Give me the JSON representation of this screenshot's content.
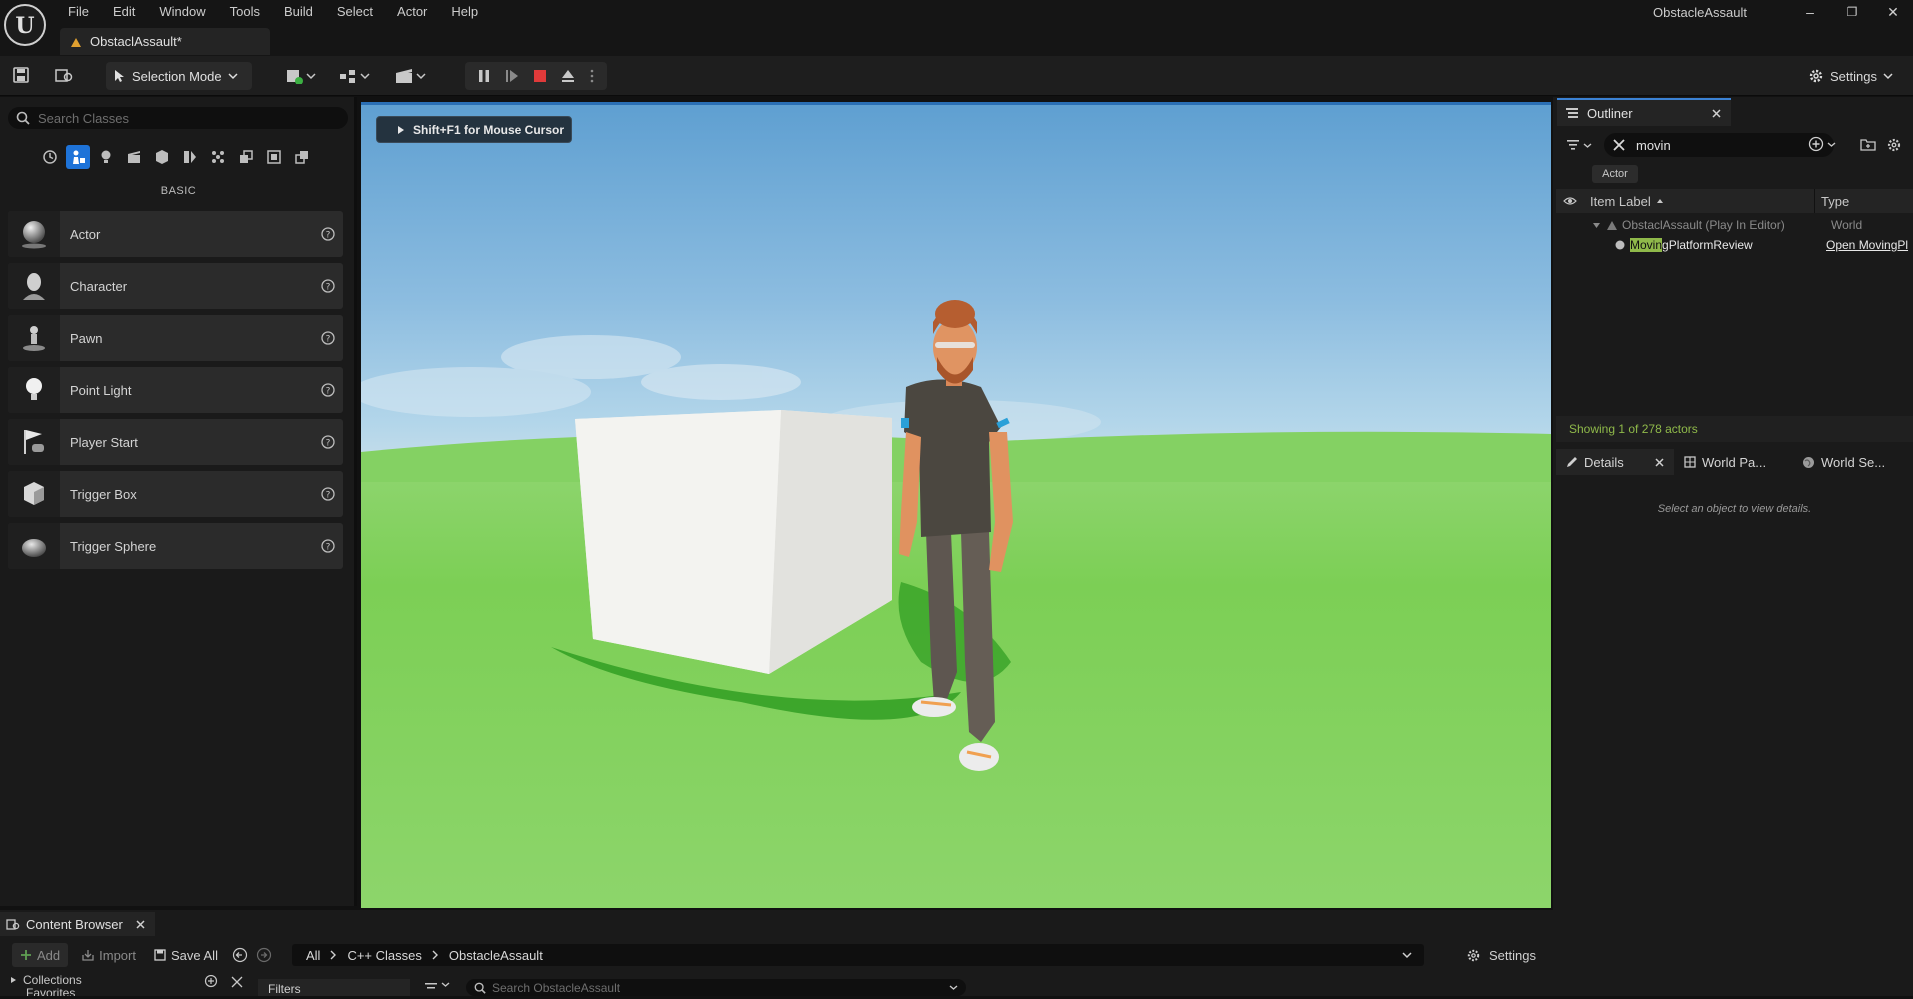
{
  "titlebar": {
    "menu": [
      "File",
      "Edit",
      "Window",
      "Tools",
      "Build",
      "Select",
      "Actor",
      "Help"
    ],
    "doc_tab": "ObstaclAssault*",
    "project_name": "ObstacleAssault",
    "minimize": "–",
    "restore": "❐",
    "close": "✕"
  },
  "toolbar": {
    "selection_mode": "Selection Mode",
    "settings": "Settings"
  },
  "place_actors": {
    "search_placeholder": "Search Classes",
    "category_label": "BASIC",
    "items": [
      {
        "label": "Actor",
        "thumb": "sphere"
      },
      {
        "label": "Character",
        "thumb": "head"
      },
      {
        "label": "Pawn",
        "thumb": "pawn"
      },
      {
        "label": "Point Light",
        "thumb": "bulb"
      },
      {
        "label": "Player Start",
        "thumb": "flag"
      },
      {
        "label": "Trigger Box",
        "thumb": "box"
      },
      {
        "label": "Trigger Sphere",
        "thumb": "sphere2"
      }
    ]
  },
  "viewport": {
    "hint": "Shift+F1 for Mouse Cursor"
  },
  "outliner": {
    "tab_label": "Outliner",
    "search_value": "movin",
    "filter_chip": "Actor",
    "col_label": "Item Label",
    "col_type": "Type",
    "rows": [
      {
        "label": "ObstaclAssault (Play In Editor)",
        "type": "World"
      },
      {
        "label_highlight": "Movin",
        "label_rest": "gPlatformReview",
        "type": "Open MovingPl"
      }
    ],
    "showing": "Showing 1 of 278 actors"
  },
  "details": {
    "tabs": [
      "Details",
      "World Pa...",
      "World Se..."
    ],
    "empty_message": "Select an object to view details."
  },
  "content_browser": {
    "tab_label": "Content Browser",
    "add": "Add",
    "import": "Import",
    "save_all": "Save All",
    "path": [
      "All",
      "C++ Classes",
      "ObstacleAssault"
    ],
    "settings": "Settings",
    "collections": "Collections",
    "favorites": "Favorites",
    "filters": "Filters",
    "search_placeholder": "Search ObstacleAssault"
  },
  "colors": {
    "accent_blue": "#1e73d8",
    "stop_red": "#e03a3a",
    "highlight_green": "#8fb94a"
  }
}
